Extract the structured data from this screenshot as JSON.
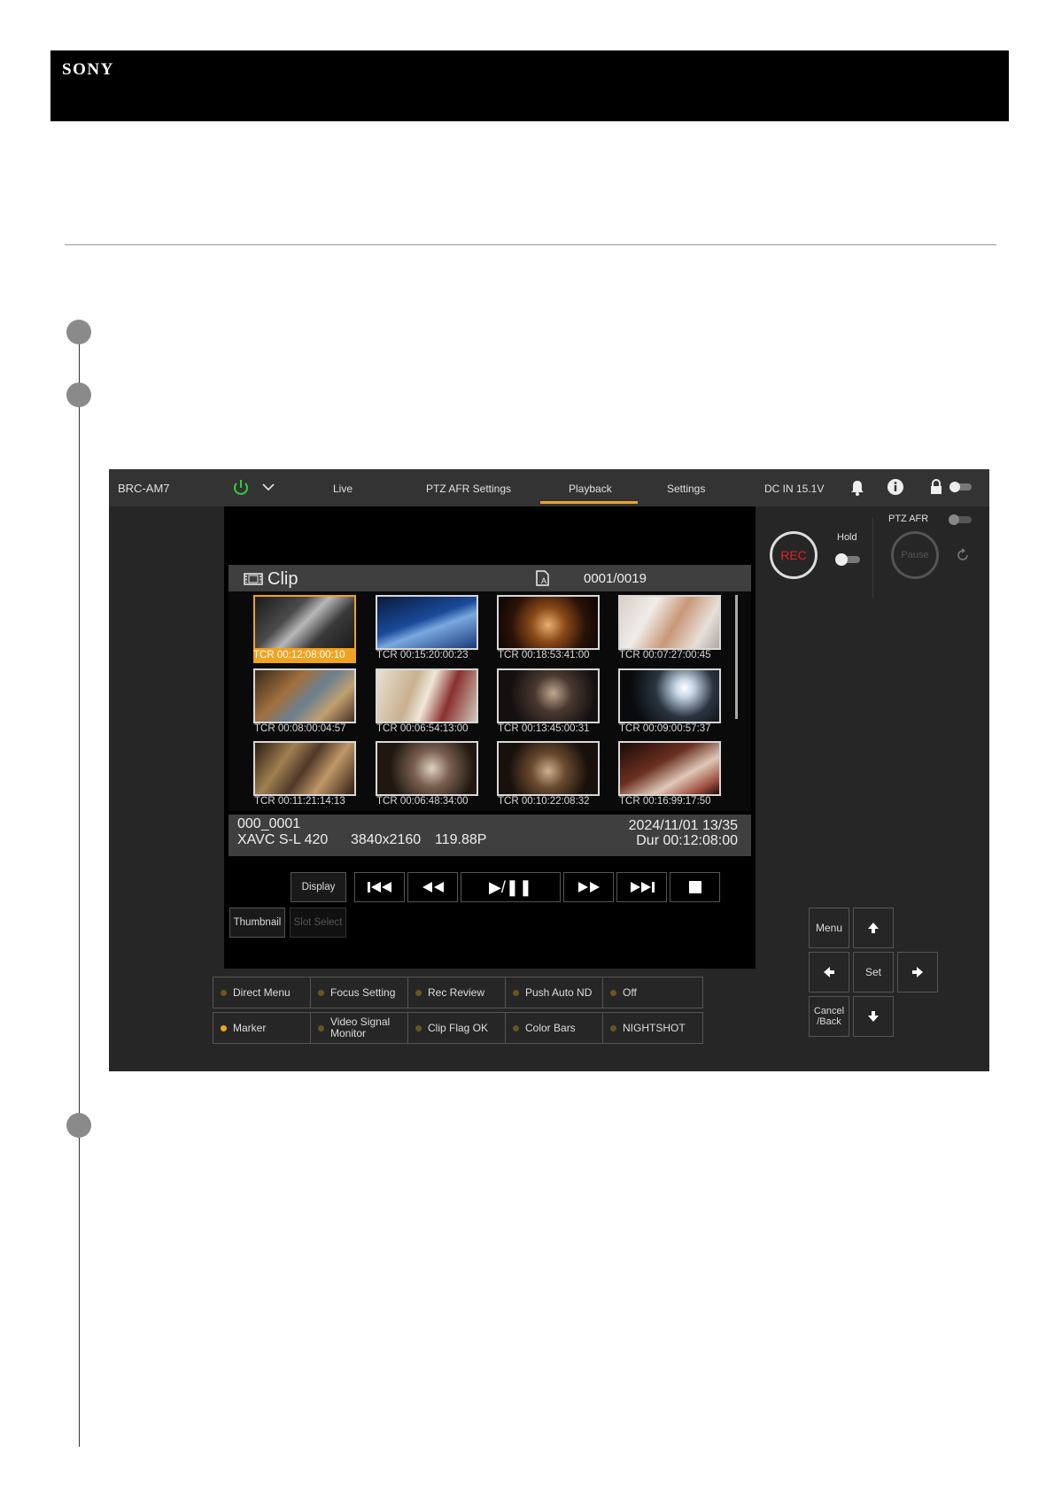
{
  "brand": {
    "logo_text": "SONY"
  },
  "app": {
    "model": "BRC-AM7",
    "nav": {
      "live": "Live",
      "ptz_afr_settings": "PTZ AFR Settings",
      "playback": "Playback",
      "settings": "Settings"
    },
    "active_tab": "Playback",
    "power_status": "DC IN 15.1V",
    "accent_color": "#f0a320",
    "power_color": "#2ecc40",
    "rec_color": "#e0202a"
  },
  "clip_list": {
    "title": "Clip",
    "counter": "0001/0019",
    "thumbnails": [
      {
        "tcr": "TCR 00:12:08:00:10",
        "selected": true
      },
      {
        "tcr": "TCR 00:15:20:00:23"
      },
      {
        "tcr": "TCR 00:18:53:41:00"
      },
      {
        "tcr": "TCR 00:07:27:00:45"
      },
      {
        "tcr": "TCR 00:08:00:04:57"
      },
      {
        "tcr": "TCR 00:06:54:13:00"
      },
      {
        "tcr": "TCR 00:13:45:00:31"
      },
      {
        "tcr": "TCR 00:09:00:57:37"
      },
      {
        "tcr": "TCR 00:11:21:14:13"
      },
      {
        "tcr": "TCR 00:06:48:34:00"
      },
      {
        "tcr": "TCR 00:10:22:08:32"
      },
      {
        "tcr": "TCR 00:16:99:17:50"
      }
    ],
    "info": {
      "clip_name": "000_0001",
      "codec": "XAVC S-L 420",
      "resolution": "3840x2160",
      "frame_rate": "119.88P",
      "date": "2024/11/01 13/35",
      "duration": "Dur 00:12:08:00"
    }
  },
  "playback_controls": {
    "display": "Display",
    "thumbnail": "Thumbnail",
    "slot_select": "Slot Select",
    "play_pause": "▶/❚❚"
  },
  "assign_buttons": [
    {
      "label": "Direct Menu",
      "on": false
    },
    {
      "label": "Focus Setting",
      "on": false
    },
    {
      "label": "Rec Review",
      "on": false
    },
    {
      "label": "Push Auto ND",
      "on": false
    },
    {
      "label": "Off",
      "on": false
    },
    {
      "label": "Marker",
      "on": true
    },
    {
      "label": "Video Signal Monitor",
      "on": false
    },
    {
      "label": "Clip Flag OK",
      "on": false
    },
    {
      "label": "Color Bars",
      "on": false
    },
    {
      "label": "NIGHTSHOT",
      "on": false
    }
  ],
  "rec_panel": {
    "rec": "REC",
    "hold": "Hold",
    "ptz_afr": "PTZ AFR",
    "pause": "Pause"
  },
  "dpad": {
    "menu": "Menu",
    "set": "Set",
    "cancel_back": "Cancel /Back"
  }
}
